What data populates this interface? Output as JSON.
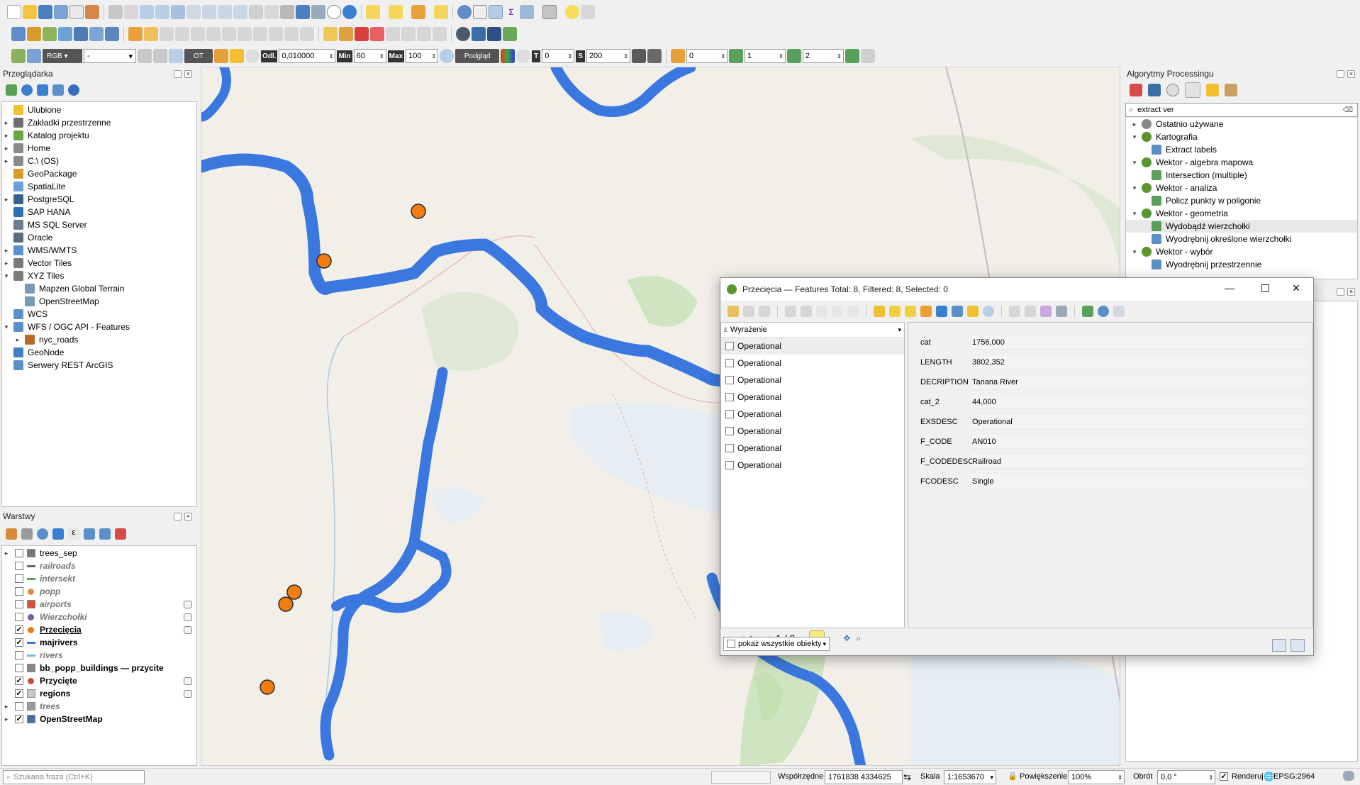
{
  "toolbar3": {
    "rgb_label": "RGB",
    "band_value": "-",
    "ot_label": "OT",
    "odl_label": "Odl.",
    "odl_value": "0,010000",
    "min_label": "Min",
    "min_value": "60",
    "max_label": "Max",
    "max_value": "100",
    "preview_label": "Podgląd",
    "t_label": "T",
    "t_value": "0",
    "s_label": "S",
    "s_value": "200",
    "f1_value": "0",
    "f2_value": "1",
    "f3_value": "2"
  },
  "browser": {
    "title": "Przeglądarka",
    "items": [
      {
        "label": "Ulubione",
        "icon": "star-icon",
        "arrow": "",
        "indent": 0,
        "color": "#f2c230"
      },
      {
        "label": "Zakładki przestrzenne",
        "icon": "bookmark-icon",
        "arrow": "▸",
        "indent": 0,
        "color": "#6f6f6f"
      },
      {
        "label": "Katalog projektu",
        "icon": "project-icon",
        "arrow": "▸",
        "indent": 0,
        "color": "#68a845"
      },
      {
        "label": "Home",
        "icon": "home-icon",
        "arrow": "▸",
        "indent": 0,
        "color": "#8a8a8a"
      },
      {
        "label": "C:\\ (OS)",
        "icon": "drive-icon",
        "arrow": "▸",
        "indent": 0,
        "color": "#8a8a8a"
      },
      {
        "label": "GeoPackage",
        "icon": "geopackage-icon",
        "arrow": "",
        "indent": 0,
        "color": "#d89b2e"
      },
      {
        "label": "SpatiaLite",
        "icon": "spatialite-icon",
        "arrow": "",
        "indent": 0,
        "color": "#6aa2d6"
      },
      {
        "label": "PostgreSQL",
        "icon": "postgresql-icon",
        "arrow": "▸",
        "indent": 0,
        "color": "#33628f"
      },
      {
        "label": "SAP HANA",
        "icon": "saphana-icon",
        "arrow": "",
        "indent": 0,
        "color": "#2d6fb7"
      },
      {
        "label": "MS SQL Server",
        "icon": "mssql-icon",
        "arrow": "",
        "indent": 0,
        "color": "#6b7b8c"
      },
      {
        "label": "Oracle",
        "icon": "oracle-icon",
        "arrow": "",
        "indent": 0,
        "color": "#5b6b7e"
      },
      {
        "label": "WMS/WMTS",
        "icon": "globe-icon",
        "arrow": "▸",
        "indent": 0,
        "color": "#5b8fc7"
      },
      {
        "label": "Vector Tiles",
        "icon": "vector-tiles-icon",
        "arrow": "▸",
        "indent": 0,
        "color": "#7a7a7a"
      },
      {
        "label": "XYZ Tiles",
        "icon": "xyz-tiles-icon",
        "arrow": "▾",
        "indent": 0,
        "color": "#7a7a7a"
      },
      {
        "label": "Mapzen Global Terrain",
        "icon": "tiles-icon",
        "arrow": "",
        "indent": 1,
        "color": "#7a9ab8"
      },
      {
        "label": "OpenStreetMap",
        "icon": "tiles-icon",
        "arrow": "",
        "indent": 1,
        "color": "#7a9ab8"
      },
      {
        "label": "WCS",
        "icon": "wcs-globe-icon",
        "arrow": "",
        "indent": 0,
        "color": "#5b8fc7"
      },
      {
        "label": "WFS / OGC API - Features",
        "icon": "wfs-globe-icon",
        "arrow": "▾",
        "indent": 0,
        "color": "#5b8fc7"
      },
      {
        "label": "nyc_roads",
        "icon": "line-layer-icon",
        "arrow": "▸",
        "indent": 1,
        "color": "#b56a2a"
      },
      {
        "label": "GeoNode",
        "icon": "geonode-icon",
        "arrow": "",
        "indent": 0,
        "color": "#3f80c2"
      },
      {
        "label": "Serwery REST ArcGIS",
        "icon": "arcgis-globe-icon",
        "arrow": "",
        "indent": 0,
        "color": "#5b8fc7"
      }
    ]
  },
  "layers": {
    "title": "Warstwy",
    "items": [
      {
        "label": "trees_sep",
        "checked": false,
        "style": "normal",
        "arrow": "▸",
        "sym": "raster-icon",
        "color": "#777777",
        "extra": ""
      },
      {
        "label": "railroads",
        "checked": false,
        "style": "italic",
        "arrow": "",
        "sym": "railroad-line-icon",
        "color": "#666666",
        "extra": ""
      },
      {
        "label": "intersekt",
        "checked": false,
        "style": "italic",
        "arrow": "",
        "sym": "line-icon",
        "color": "#5ea05e",
        "extra": ""
      },
      {
        "label": "popp",
        "checked": false,
        "style": "italic",
        "arrow": "",
        "sym": "point-icon",
        "color": "#d9913b",
        "extra": ""
      },
      {
        "label": "airports",
        "checked": false,
        "style": "italic",
        "arrow": "",
        "sym": "airplane-icon",
        "color": "#d0533b",
        "extra": "filter-icon"
      },
      {
        "label": "Wierzchołki",
        "checked": false,
        "style": "italic",
        "arrow": "",
        "sym": "point-icon",
        "color": "#7e5e9e",
        "extra": "memory-icon"
      },
      {
        "label": "Przecięcia",
        "checked": true,
        "style": "bold-underline",
        "arrow": "",
        "sym": "point-icon",
        "color": "#ee7c14",
        "extra": "memory-icon"
      },
      {
        "label": "majrivers",
        "checked": true,
        "style": "bold",
        "arrow": "",
        "sym": "line-icon",
        "color": "#3b78dd",
        "extra": ""
      },
      {
        "label": "rivers",
        "checked": false,
        "style": "italic",
        "arrow": "",
        "sym": "line-icon",
        "color": "#6ec0d8",
        "extra": ""
      },
      {
        "label": "bb_popp_buildings — przycite",
        "checked": false,
        "style": "bold",
        "arrow": "",
        "sym": "table-icon",
        "color": "#888888",
        "extra": ""
      },
      {
        "label": "Przycięte",
        "checked": true,
        "style": "bold",
        "arrow": "",
        "sym": "point-icon",
        "color": "#c0523a",
        "extra": "memory-icon"
      },
      {
        "label": "regions",
        "checked": true,
        "style": "bold",
        "arrow": "",
        "sym": "polygon-icon",
        "color": "#c9c9c9",
        "extra": "filter-icon"
      },
      {
        "label": "trees",
        "checked": false,
        "style": "italic",
        "arrow": "▸",
        "sym": "polygon-icon",
        "color": "#9a9a9a",
        "extra": ""
      },
      {
        "label": "OpenStreetMap",
        "checked": true,
        "style": "bold",
        "arrow": "▸",
        "sym": "tiles-icon",
        "color": "#3f6fa6",
        "extra": ""
      }
    ]
  },
  "processing": {
    "title": "Algorytmy Processingu",
    "search_value": "extract ver",
    "items": [
      {
        "label": "Ostatnio używane",
        "arrow": "▸",
        "indent": 0,
        "icon": "clock-icon",
        "color": "#888888",
        "highlight": false
      },
      {
        "label": "Kartografia",
        "arrow": "▾",
        "indent": 0,
        "icon": "qgis-q-icon",
        "color": "#589632",
        "highlight": false
      },
      {
        "label": "Extract labels",
        "arrow": "",
        "indent": 1,
        "icon": "gear-icon",
        "color": "#5b8fc7",
        "highlight": false
      },
      {
        "label": "Wektor - algebra mapowa",
        "arrow": "▾",
        "indent": 0,
        "icon": "qgis-q-icon",
        "color": "#589632",
        "highlight": false
      },
      {
        "label": "Intersection (multiple)",
        "arrow": "",
        "indent": 1,
        "icon": "intersection-icon",
        "color": "#5aa05a",
        "highlight": false
      },
      {
        "label": "Wektor - analiza",
        "arrow": "▾",
        "indent": 0,
        "icon": "qgis-q-icon",
        "color": "#589632",
        "highlight": false
      },
      {
        "label": "Policz punkty w poligonie",
        "arrow": "",
        "indent": 1,
        "icon": "count-points-icon",
        "color": "#5aa05a",
        "highlight": false
      },
      {
        "label": "Wektor - geometria",
        "arrow": "▾",
        "indent": 0,
        "icon": "qgis-q-icon",
        "color": "#589632",
        "highlight": false
      },
      {
        "label": "Wydobądź wierzchołki",
        "arrow": "",
        "indent": 1,
        "icon": "vertices-icon",
        "color": "#5aa05a",
        "highlight": true
      },
      {
        "label": "Wyodrębnij określone wierzchołki",
        "arrow": "",
        "indent": 1,
        "icon": "gear-icon",
        "color": "#5b8fc7",
        "highlight": false
      },
      {
        "label": "Wektor - wybór",
        "arrow": "▾",
        "indent": 0,
        "icon": "qgis-q-icon",
        "color": "#589632",
        "highlight": false
      },
      {
        "label": "Wyodrębnij przestrzennie",
        "arrow": "",
        "indent": 1,
        "icon": "gear-icon",
        "color": "#5b8fc7",
        "highlight": false
      }
    ]
  },
  "attr_dialog": {
    "title": "Przecięcia — Features Total: 8, Filtered: 8, Selected: 0",
    "expression_label": "Wyrażenie",
    "list": [
      "Operational",
      "Operational",
      "Operational",
      "Operational",
      "Operational",
      "Operational",
      "Operational",
      "Operational"
    ],
    "fields": [
      {
        "name": "cat",
        "value": "1756,000"
      },
      {
        "name": "LENGTH",
        "value": "3802,352"
      },
      {
        "name": "DECRIPTION",
        "value": "Tanana River"
      },
      {
        "name": "cat_2",
        "value": "44,000"
      },
      {
        "name": "EXSDESC",
        "value": "Operational"
      },
      {
        "name": "F_CODE",
        "value": "AN010"
      },
      {
        "name": "F_CODEDESC",
        "value": "Railroad"
      },
      {
        "name": "FCODESC",
        "value": "Single"
      }
    ],
    "nav_label": "1 / 8",
    "filter_label": "pokaż wszystkie obiekty"
  },
  "statusbar": {
    "search_placeholder": "Szukana fraza (Ctrl+K)",
    "coord_label": "Współrzędne",
    "coord_value": "1761838 4334625",
    "scale_label": "Skala",
    "scale_value": "1:1653670",
    "zoom_label": "Powiększenie",
    "zoom_value": "100%",
    "rotation_label": "Obrót",
    "rotation_value": "0,0 °",
    "render_label": "Renderuj",
    "crs_label": "EPSG:2964"
  },
  "colors": {
    "river": "#3a78df",
    "intersection_point": "#f07d12",
    "map_bg": "#f2efe9"
  }
}
